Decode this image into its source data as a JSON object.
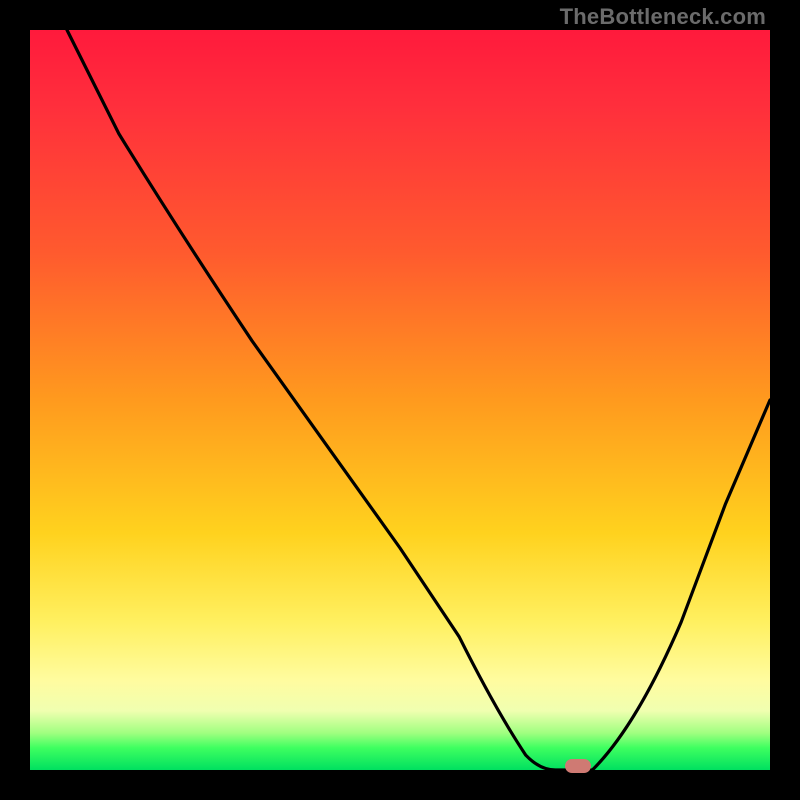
{
  "watermark": "TheBottleneck.com",
  "colors": {
    "frame": "#000000",
    "gradient_top": "#ff1a3c",
    "gradient_mid": "#ffd21e",
    "gradient_low": "#fffca0",
    "gradient_bottom": "#00e060",
    "curve": "#000000",
    "marker": "#cf7a73"
  },
  "chart_data": {
    "type": "line",
    "title": "",
    "xlabel": "",
    "ylabel": "",
    "xlim": [
      0,
      100
    ],
    "ylim": [
      0,
      100
    ],
    "grid": false,
    "legend": false,
    "series": [
      {
        "name": "bottleneck-curve",
        "x": [
          5,
          12,
          20,
          30,
          40,
          50,
          58,
          63,
          67,
          71,
          76,
          82,
          88,
          94,
          100
        ],
        "values": [
          100,
          86,
          73,
          58,
          44,
          30,
          18,
          8,
          2,
          0,
          0,
          6,
          20,
          36,
          50
        ]
      }
    ],
    "marker": {
      "x": 74,
      "y": 0
    },
    "annotations": []
  }
}
